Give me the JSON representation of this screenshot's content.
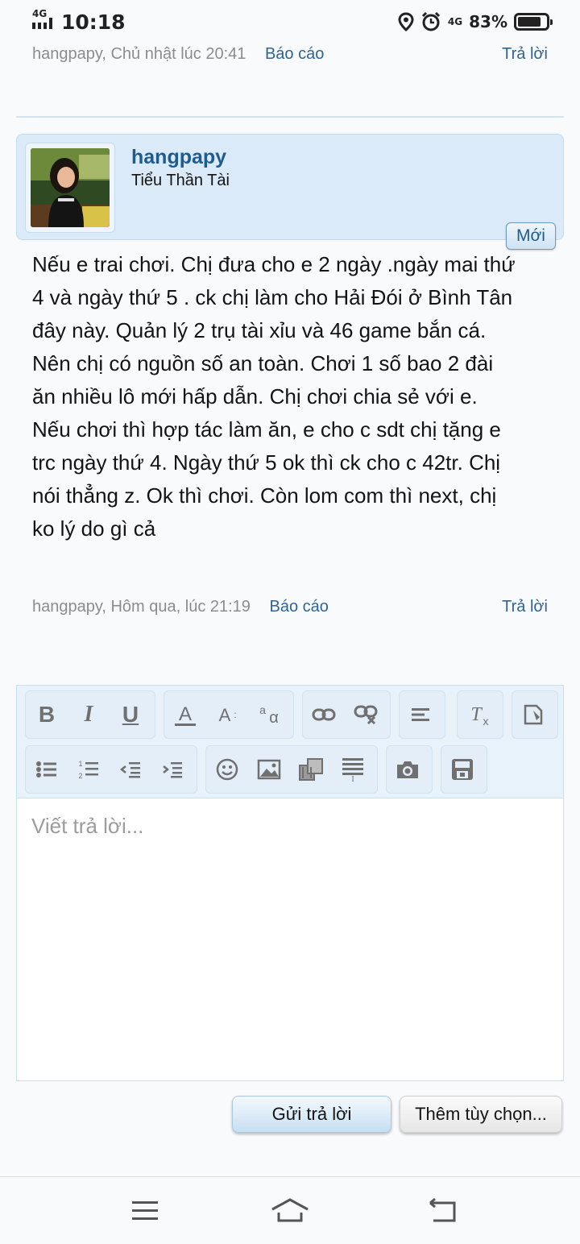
{
  "status_bar": {
    "network_left": "4G",
    "time": "10:18",
    "network_right": "4G",
    "battery_percent": "83%",
    "battery_level": 0.83
  },
  "previous_post": {
    "meta": "hangpapy, Chủ nhật lúc 20:41",
    "report": "Báo cáo",
    "reply": "Trả lời"
  },
  "post": {
    "username": "hangpapy",
    "user_title": "Tiểu Thần Tài",
    "badge": "Mới",
    "message": "Nếu e trai chơi. Chị đưa cho e 2 ngày .ngày mai thứ 4 và ngày thứ 5 . ck chị làm cho Hải Đói ở Bình Tân đây này. Quản lý 2 trụ tài xỉu và 46 game bắn cá. Nên chị có nguồn số an toàn. Chơi 1 số bao 2 đài ăn nhiều lô mới hấp dẫn. Chị chơi chia sẻ với e. Nếu chơi thì hợp tác làm ăn, e cho c sdt chị tặng e trc ngày thứ 4. Ngày thứ 5 ok thì ck cho c 42tr. Chị nói thẳng z. Ok thì chơi. Còn lom com thì next, chị ko lý do gì cả",
    "meta": "hangpapy, Hôm qua, lúc 21:19",
    "report": "Báo cáo",
    "reply": "Trả lời"
  },
  "editor": {
    "placeholder": "Viết trả lời...",
    "toolbar_icons": [
      "bold-icon",
      "italic-icon",
      "underline-icon",
      "font-color-icon",
      "font-size-icon",
      "font-family-icon",
      "link-icon",
      "unlink-icon",
      "align-icon",
      "remove-format-icon",
      "toggle-bbcode-icon",
      "bullet-list-icon",
      "numbered-list-icon",
      "outdent-icon",
      "indent-icon",
      "smiley-icon",
      "image-icon",
      "media-icon",
      "insert-icon",
      "camera-icon",
      "save-draft-icon"
    ]
  },
  "actions": {
    "send": "Gửi trả lời",
    "more": "Thêm tùy chọn..."
  },
  "navbar": {
    "icons": [
      "menu-icon",
      "home-icon",
      "back-icon"
    ]
  }
}
